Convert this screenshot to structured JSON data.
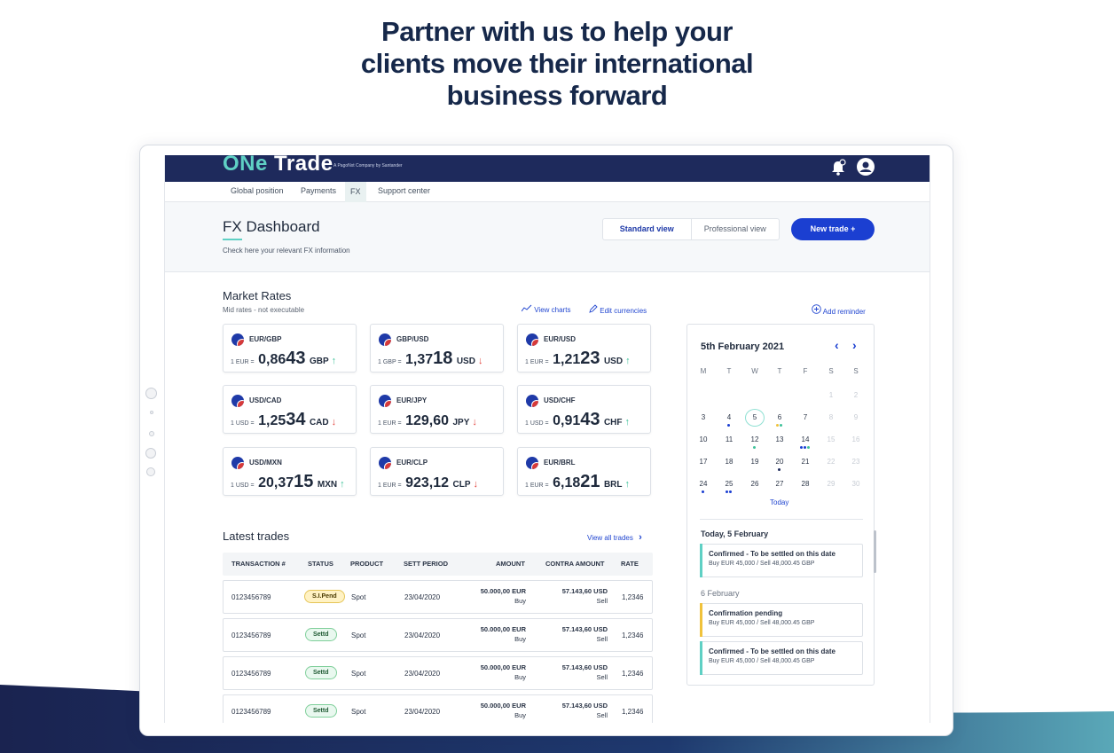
{
  "hero": {
    "line1": "Partner with us to help your",
    "line2": "clients move their international",
    "line3": "business forward"
  },
  "app": {
    "brand_one": "ONe",
    "brand_trade": "Trade",
    "brand_sub": "A PagoNxt Company by Santander"
  },
  "nav": {
    "items": [
      "Global position",
      "Payments",
      "FX",
      "Support center"
    ],
    "active": "FX"
  },
  "header": {
    "title": "FX Dashboard",
    "subtitle": "Check here your relevant FX information",
    "standard_view": "Standard view",
    "professional_view": "Professional view",
    "new_trade": "New trade +"
  },
  "market": {
    "title": "Market Rates",
    "subtitle": "Mid rates - not executable",
    "view_charts": "View charts",
    "edit_currencies": "Edit currencies",
    "add_reminder": "Add reminder",
    "cards": [
      {
        "pair": "EUR/GBP",
        "prefix": "1 EUR =",
        "rate": "0,86",
        "rate_big": "43",
        "currency": "GBP",
        "trend": "up"
      },
      {
        "pair": "GBP/USD",
        "prefix": "1 GBP =",
        "rate": "1,37",
        "rate_big": "18",
        "currency": "USD",
        "trend": "down"
      },
      {
        "pair": "EUR/USD",
        "prefix": "1 EUR =",
        "rate": "1,21",
        "rate_big": "23",
        "currency": "USD",
        "trend": "up"
      },
      {
        "pair": "USD/CAD",
        "prefix": "1 USD =",
        "rate": "1,25",
        "rate_big": "34",
        "currency": "CAD",
        "trend": "down"
      },
      {
        "pair": "EUR/JPY",
        "prefix": "1 EUR =",
        "rate": "129,60",
        "rate_big": "",
        "currency": "JPY",
        "trend": "down"
      },
      {
        "pair": "USD/CHF",
        "prefix": "1 USD =",
        "rate": "0,91",
        "rate_big": "43",
        "currency": "CHF",
        "trend": "up"
      },
      {
        "pair": "USD/MXN",
        "prefix": "1 USD =",
        "rate": "20,37",
        "rate_big": "15",
        "currency": "MXN",
        "trend": "up"
      },
      {
        "pair": "EUR/CLP",
        "prefix": "1 EUR =",
        "rate": "923,12",
        "rate_big": "",
        "currency": "CLP",
        "trend": "down"
      },
      {
        "pair": "EUR/BRL",
        "prefix": "1 EUR =",
        "rate": "6,18",
        "rate_big": "21",
        "currency": "BRL",
        "trend": "up"
      }
    ],
    "arrow_up": "↑",
    "arrow_down": "↓"
  },
  "calendar": {
    "title": "5th February 2021",
    "weekdays": [
      "M",
      "T",
      "W",
      "T",
      "F",
      "S",
      "S"
    ],
    "today_link": "Today",
    "events_today_title": "Today, 5 February",
    "events_next_title": "6 February",
    "events": [
      {
        "title": "Confirmed - To be settled on this date",
        "detail": "Buy EUR 45,000 / Sell 48,000.45 GBP",
        "color": "#5fd0c4"
      },
      {
        "title": "Confirmation pending",
        "detail": "Buy EUR 45,000 / Sell 48,000.45 GBP",
        "color": "#f0c23b"
      },
      {
        "title": "Confirmed - To be settled on this date",
        "detail": "Buy EUR 45,000 / Sell 48,000.45 GBP",
        "color": "#5fd0c4"
      }
    ]
  },
  "trades": {
    "title": "Latest trades",
    "view_all": "View all trades",
    "columns": [
      "TRANSACTION #",
      "STATUS",
      "PRODUCT",
      "SETT PERIOD",
      "AMOUNT",
      "CONTRA AMOUNT",
      "RATE"
    ],
    "rows": [
      {
        "id": "0123456789",
        "status": "S.I.Pend",
        "product": "Spot",
        "period": "23/04/2020",
        "amount": "50.000,00 EUR",
        "amount_side": "Buy",
        "contra": "57.143,60 USD",
        "contra_side": "Sell",
        "rate": "1,2346"
      },
      {
        "id": "0123456789",
        "status": "Settd",
        "product": "Spot",
        "period": "23/04/2020",
        "amount": "50.000,00 EUR",
        "amount_side": "Buy",
        "contra": "57.143,60 USD",
        "contra_side": "Sell",
        "rate": "1,2346"
      },
      {
        "id": "0123456789",
        "status": "Settd",
        "product": "Spot",
        "period": "23/04/2020",
        "amount": "50.000,00 EUR",
        "amount_side": "Buy",
        "contra": "57.143,60 USD",
        "contra_side": "Sell",
        "rate": "1,2346"
      },
      {
        "id": "0123456789",
        "status": "Settd",
        "product": "Spot",
        "period": "23/04/2020",
        "amount": "50.000,00 EUR",
        "amount_side": "Buy",
        "contra": "57.143,60 USD",
        "contra_side": "Sell",
        "rate": "1,2346"
      }
    ]
  },
  "colors": {
    "navy": "#1e2a5c",
    "primary": "#1b3fd1",
    "teal": "#5fd0c4",
    "up": "#3ec29a",
    "down": "#e2423c"
  }
}
